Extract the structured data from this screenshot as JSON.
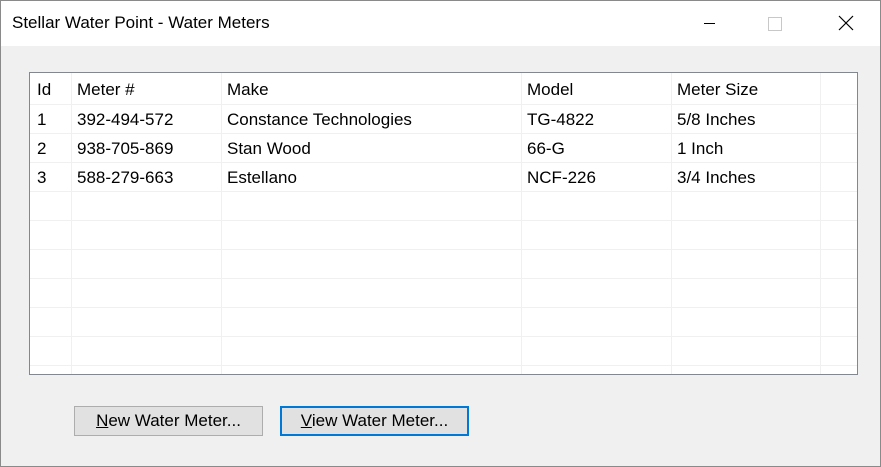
{
  "window": {
    "title": "Stellar Water Point - Water Meters"
  },
  "list": {
    "columns": [
      "Id",
      "Meter #",
      "Make",
      "Model",
      "Meter Size"
    ],
    "rows": [
      [
        "1",
        "392-494-572",
        "Constance Technologies",
        "TG-4822",
        "5/8 Inches"
      ],
      [
        "2",
        "938-705-869",
        "Stan Wood",
        "66-G",
        "1 Inch"
      ],
      [
        "3",
        "588-279-663",
        "Estellano",
        "NCF-226",
        "3/4 Inches"
      ]
    ]
  },
  "buttons": {
    "new_mnemonic": "N",
    "new_rest": "ew Water Meter...",
    "view_mnemonic": "V",
    "view_rest": "iew Water Meter..."
  },
  "colors": {
    "focus_border": "#0078d7",
    "gridline": "#f0f0f0",
    "window_bg": "#f0f0f0"
  },
  "icons": {
    "minimize": "minimize-icon",
    "maximize": "maximize-icon",
    "close": "close-icon"
  }
}
